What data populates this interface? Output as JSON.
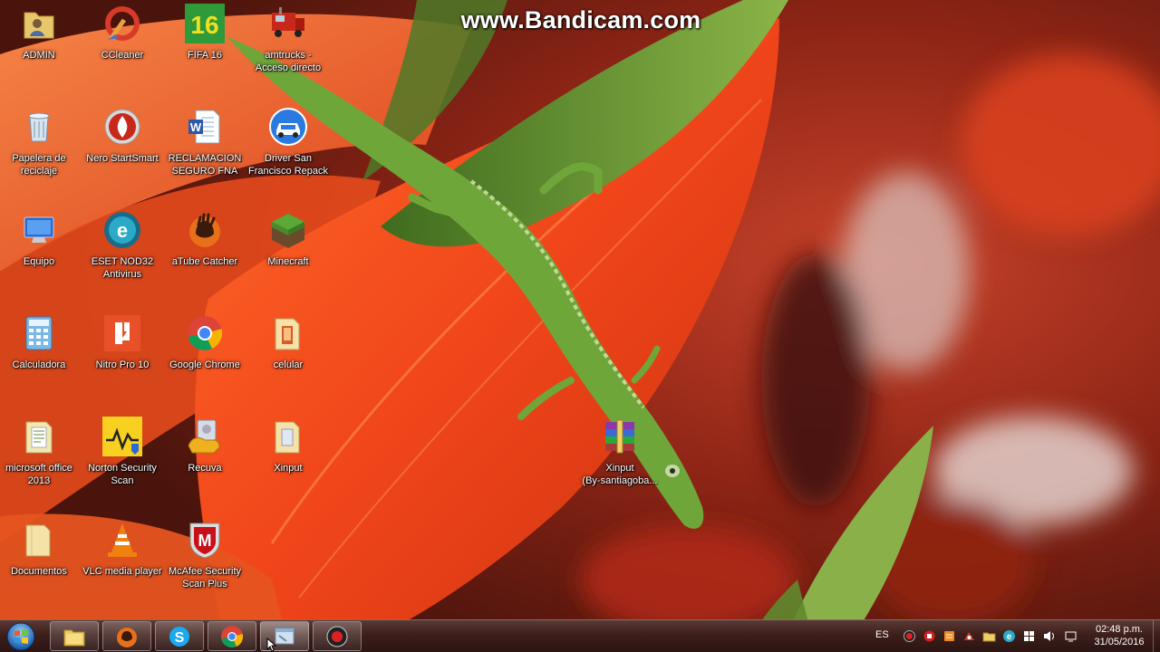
{
  "watermark": "www.Bandicam.com",
  "desktop_icons": [
    {
      "label": "ADMIN",
      "icon": "user-folder-icon"
    },
    {
      "label": "CCleaner",
      "icon": "ccleaner-icon"
    },
    {
      "label": "FIFA 16",
      "icon": "fifa-16-icon"
    },
    {
      "label": "amtrucks -\nAcceso directo",
      "icon": "truck-icon"
    },
    {
      "label": "Papelera de\nreciclaje",
      "icon": "recycle-bin-icon"
    },
    {
      "label": "Nero StartSmart",
      "icon": "nero-icon"
    },
    {
      "label": "RECLAMACION\nSEGURO FNA",
      "icon": "word-document-icon"
    },
    {
      "label": "Driver San\nFrancisco Repack",
      "icon": "car-game-icon"
    },
    {
      "label": "Equipo",
      "icon": "computer-icon"
    },
    {
      "label": "ESET NOD32\nAntivirus",
      "icon": "eset-icon"
    },
    {
      "label": "aTube Catcher",
      "icon": "atube-catcher-icon"
    },
    {
      "label": "Minecraft",
      "icon": "minecraft-icon"
    },
    {
      "label": "Calculadora",
      "icon": "calculator-icon"
    },
    {
      "label": "Nitro Pro 10",
      "icon": "nitro-pdf-icon"
    },
    {
      "label": "Google Chrome",
      "icon": "chrome-icon"
    },
    {
      "label": "celular",
      "icon": "folder-icon"
    },
    {
      "label": "microsoft office\n2013",
      "icon": "folder-icon"
    },
    {
      "label": "Norton Security\nScan",
      "icon": "norton-icon"
    },
    {
      "label": "Recuva",
      "icon": "recuva-icon"
    },
    {
      "label": "Xinput",
      "icon": "folder-icon"
    },
    {
      "label": "Xinput\n(By-santiagoba...",
      "icon": "winrar-archive-icon"
    },
    {
      "label": "Documentos",
      "icon": "folder-icon"
    },
    {
      "label": "VLC media player",
      "icon": "vlc-icon"
    },
    {
      "label": "McAfee Security\nScan Plus",
      "icon": "mcafee-icon"
    }
  ],
  "taskbar": {
    "start_icon": "windows-start-icon",
    "pinned": [
      {
        "icon": "file-explorer-icon",
        "active": false
      },
      {
        "icon": "atube-catcher-icon",
        "active": false
      },
      {
        "icon": "skype-icon",
        "active": false
      },
      {
        "icon": "chrome-icon",
        "active": false
      },
      {
        "icon": "window-app-icon",
        "active": true
      },
      {
        "icon": "bandicam-icon",
        "active": false
      }
    ],
    "tray": {
      "language": "ES",
      "icons": [
        "record-icon",
        "bandicam-tray-icon",
        "notification-icon",
        "network-tool-icon",
        "folder-sync-icon",
        "eset-tray-icon",
        "windows-flag-icon",
        "volume-icon",
        "action-center-icon"
      ],
      "time": "02:48 p.m.",
      "date": "31/05/2016"
    }
  }
}
